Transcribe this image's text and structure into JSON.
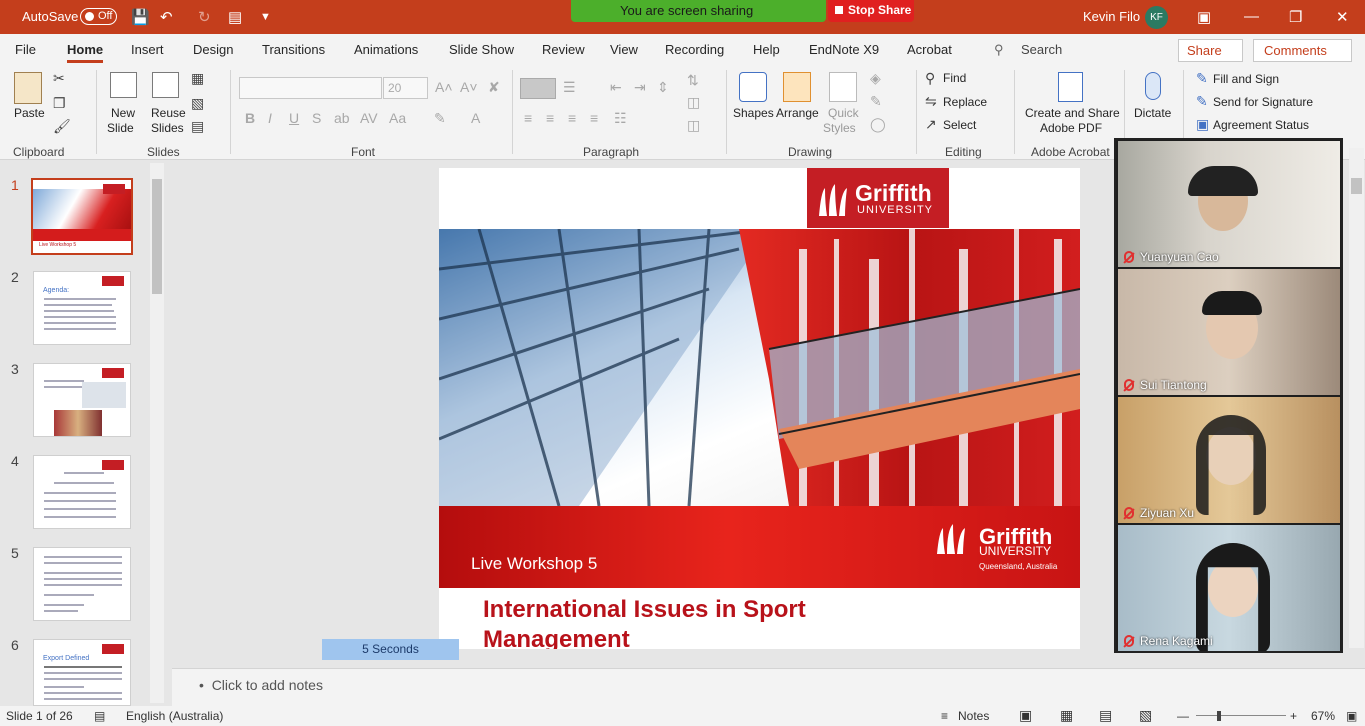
{
  "titlebar": {
    "autosave": "AutoSave",
    "autosave_state": "Off",
    "user_name": "Kevin Filo",
    "user_initials": "KF"
  },
  "screen_share": {
    "message": "You are screen sharing",
    "stop_label": "Stop Share"
  },
  "tabs": [
    "File",
    "Home",
    "Insert",
    "Design",
    "Transitions",
    "Animations",
    "Slide Show",
    "Review",
    "View",
    "Recording",
    "Help",
    "EndNote X9",
    "Acrobat"
  ],
  "active_tab": "Home",
  "search_label": "Search",
  "share_label": "Share",
  "comments_label": "Comments",
  "ribbon": {
    "paste": "Paste",
    "clipboard": "Clipboard",
    "new_slide_1": "New",
    "new_slide_2": "Slide",
    "reuse_1": "Reuse",
    "reuse_2": "Slides",
    "slides": "Slides",
    "font_size": "20",
    "font": "Font",
    "paragraph": "Paragraph",
    "shapes": "Shapes",
    "arrange": "Arrange",
    "quick_1": "Quick",
    "quick_2": "Styles",
    "drawing": "Drawing",
    "find": "Find",
    "replace": "Replace",
    "select": "Select",
    "editing": "Editing",
    "create_1": "Create and Share",
    "create_2": "Adobe PDF",
    "adobe": "Adobe Acrobat",
    "dictate": "Dictate",
    "fill_sign": "Fill and Sign",
    "send_sig": "Send for Signature",
    "agreement": "Agreement Status"
  },
  "thumbnails": [
    {
      "num": "1",
      "caption": "Live Workshop 5"
    },
    {
      "num": "2",
      "title": "Agenda:"
    },
    {
      "num": "3"
    },
    {
      "num": "4"
    },
    {
      "num": "5"
    },
    {
      "num": "6",
      "title": "Export Defined"
    }
  ],
  "slide": {
    "logo_main": "Griffith",
    "logo_sub": "UNIVERSITY",
    "logo_place": "Queensland, Australia",
    "workshop": "Live Workshop 5",
    "title_line1": "International Issues in Sport",
    "title_line2": "Management"
  },
  "timer_label": "5 Seconds",
  "notes_placeholder": "Click to add notes",
  "participants": [
    {
      "name": "Yuanyuan Cao"
    },
    {
      "name": "Sui Tiantong"
    },
    {
      "name": "Ziyuan Xu"
    },
    {
      "name": "Rena Kagami"
    }
  ],
  "status": {
    "slide_of": "Slide 1 of 26",
    "language": "English (Australia)",
    "notes": "Notes",
    "zoom": "67%"
  },
  "colors": {
    "accent": "#c43e1c",
    "brand_red": "#c41e24",
    "share_green": "#4caf2b"
  }
}
